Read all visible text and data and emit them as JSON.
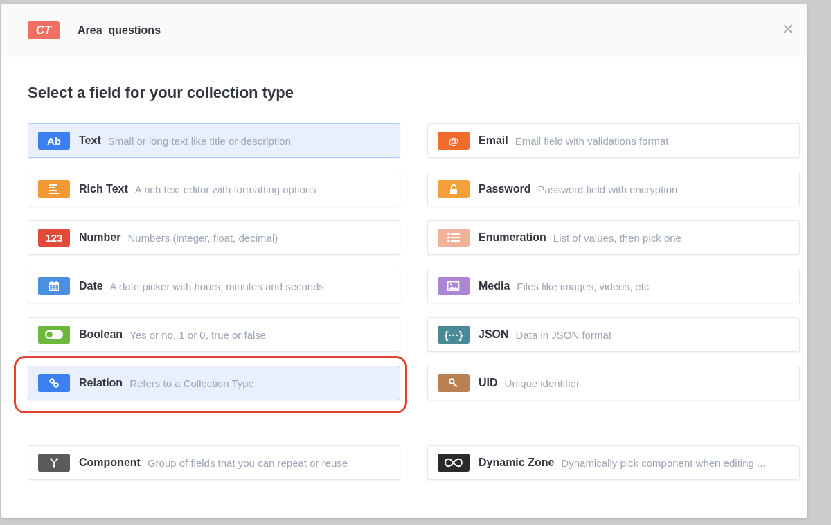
{
  "modal": {
    "badge": "CT",
    "title": "Area_questions",
    "close": "×"
  },
  "heading": "Select a field for your collection type",
  "fields": [
    {
      "name": "Text",
      "description": "Small or long text like title or description",
      "kind": "text",
      "icon_text": "Ab",
      "color": "#3b7ff0",
      "selected": true,
      "highlighted": false
    },
    {
      "name": "Email",
      "description": "Email field with validations format",
      "kind": "text",
      "icon_text": "@",
      "color": "#f06b2c",
      "selected": false,
      "highlighted": false
    },
    {
      "name": "Rich Text",
      "description": "A rich text editor with formatting options",
      "kind": "lines",
      "color": "#f29935",
      "selected": false,
      "highlighted": false
    },
    {
      "name": "Password",
      "description": "Password field with encryption",
      "kind": "lock",
      "color": "#f3a03c",
      "selected": false,
      "highlighted": false
    },
    {
      "name": "Number",
      "description": "Numbers (integer, float, decimal)",
      "kind": "text",
      "icon_text": "123",
      "color": "#df4b38",
      "selected": false,
      "highlighted": false
    },
    {
      "name": "Enumeration",
      "description": "List of values, then pick one",
      "kind": "list",
      "color": "#efb39a",
      "selected": false,
      "highlighted": false
    },
    {
      "name": "Date",
      "description": "A date picker with hours, minutes and seconds",
      "kind": "calendar",
      "color": "#4a90e0",
      "selected": false,
      "highlighted": false
    },
    {
      "name": "Media",
      "description": "Files like images, videos, etc",
      "kind": "image",
      "color": "#ad86d3",
      "selected": false,
      "highlighted": false
    },
    {
      "name": "Boolean",
      "description": "Yes or no, 1 or 0, true or false",
      "kind": "toggle",
      "color": "#6bb83a",
      "selected": false,
      "highlighted": false
    },
    {
      "name": "JSON",
      "description": "Data in JSON format",
      "kind": "text",
      "icon_text": "{···}",
      "color": "#4a8a96",
      "selected": false,
      "highlighted": false
    },
    {
      "name": "Relation",
      "description": "Refers to a Collection Type",
      "kind": "link",
      "color": "#3b7ff0",
      "selected": true,
      "highlighted": true
    },
    {
      "name": "UID",
      "description": "Unique identifier",
      "kind": "key",
      "color": "#b98052",
      "selected": false,
      "highlighted": false
    }
  ],
  "extra_fields": [
    {
      "name": "Component",
      "description": "Group of fields that you can repeat or reuse",
      "kind": "fork",
      "color": "#5b5b5b",
      "selected": false,
      "highlighted": false
    },
    {
      "name": "Dynamic Zone",
      "description": "Dynamically pick component when editing ...",
      "kind": "infinity",
      "color": "#2b2b2b",
      "selected": false,
      "highlighted": false
    }
  ]
}
